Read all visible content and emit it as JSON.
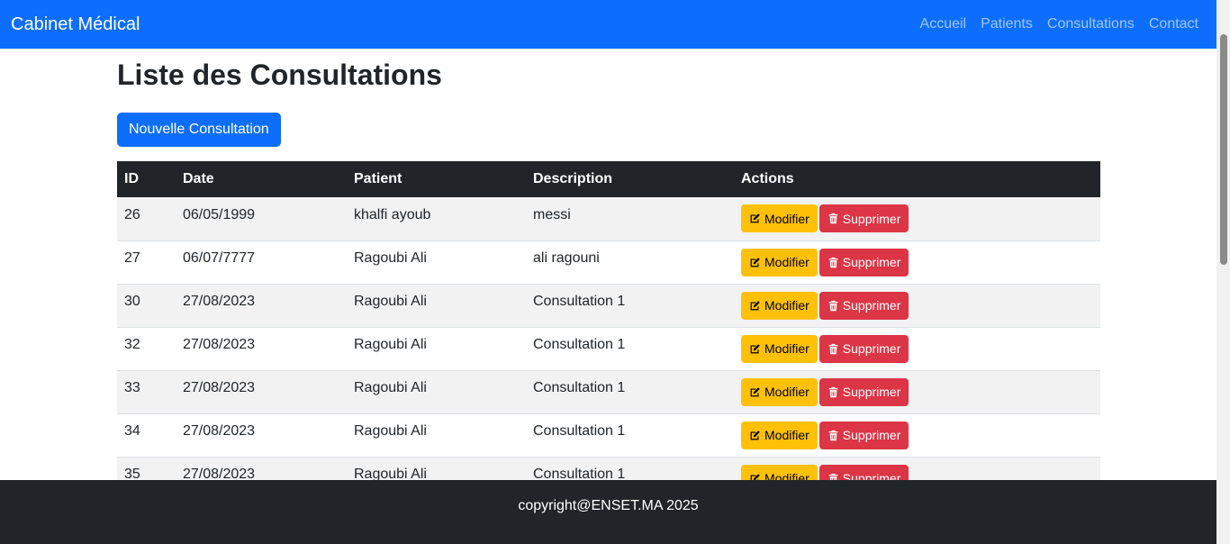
{
  "navbar": {
    "brand": "Cabinet Médical",
    "links": [
      "Accueil",
      "Patients",
      "Consultations",
      "Contact"
    ],
    "color": "#0d6efd"
  },
  "page": {
    "title": "Liste des Consultations",
    "new_button_label": "Nouvelle Consultation"
  },
  "table": {
    "headers": [
      "ID",
      "Date",
      "Patient",
      "Description",
      "Actions"
    ],
    "rows": [
      {
        "id": "26",
        "date": "06/05/1999",
        "patient": "khalfi ayoub",
        "description": "messi"
      },
      {
        "id": "27",
        "date": "06/07/7777",
        "patient": "Ragoubi Ali",
        "description": "ali ragouni"
      },
      {
        "id": "30",
        "date": "27/08/2023",
        "patient": "Ragoubi Ali",
        "description": "Consultation 1"
      },
      {
        "id": "32",
        "date": "27/08/2023",
        "patient": "Ragoubi Ali",
        "description": "Consultation 1"
      },
      {
        "id": "33",
        "date": "27/08/2023",
        "patient": "Ragoubi Ali",
        "description": "Consultation 1"
      },
      {
        "id": "34",
        "date": "27/08/2023",
        "patient": "Ragoubi Ali",
        "description": "Consultation 1"
      },
      {
        "id": "35",
        "date": "27/08/2023",
        "patient": "Ragoubi Ali",
        "description": "Consultation 1"
      }
    ],
    "actions": {
      "edit_label": "Modifier",
      "edit_icon": "edit-icon",
      "delete_label": "Supprimer",
      "delete_icon": "trash-icon"
    }
  },
  "footer": {
    "text": "copyright@ENSET.MA 2025"
  }
}
